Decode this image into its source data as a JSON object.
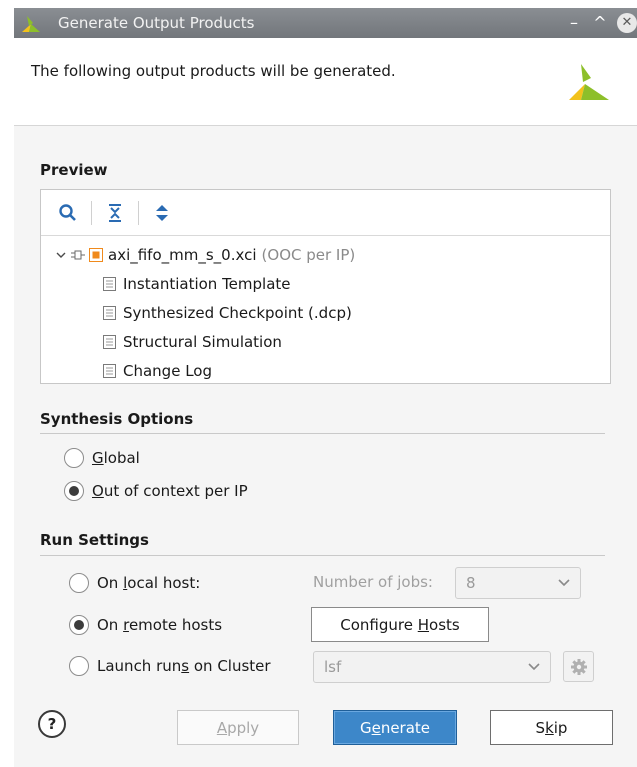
{
  "window": {
    "title": "Generate Output Products",
    "minimize": "–",
    "maximize": "^",
    "close": "✕"
  },
  "header": {
    "description": "The following output products will be generated."
  },
  "preview": {
    "title": "Preview",
    "tree": {
      "root": {
        "name": "axi_fifo_mm_s_0.xci",
        "note": "(OOC per IP)"
      },
      "children": [
        "Instantiation Template",
        "Synthesized Checkpoint (.dcp)",
        "Structural Simulation",
        "Change Log"
      ]
    }
  },
  "synthesis_options": {
    "title": "Synthesis Options",
    "options": [
      {
        "mnemonic": "G",
        "rest": "lobal",
        "selected": false
      },
      {
        "mnemonic": "O",
        "rest": "ut of context per IP",
        "selected": true
      }
    ]
  },
  "run_settings": {
    "title": "Run Settings",
    "local_host": {
      "before": "On ",
      "mnemonic": "l",
      "after": "ocal host:",
      "selected": false
    },
    "jobs_label": "Number of jobs:",
    "jobs_value": "8",
    "remote_hosts": {
      "before": "On ",
      "mnemonic": "r",
      "after": "emote hosts",
      "selected": true
    },
    "configure_hosts": {
      "before": "Configure ",
      "mnemonic": "H",
      "after": "osts"
    },
    "cluster": {
      "before": "Launch run",
      "mnemonic": "s",
      "after": " on Cluster",
      "selected": false
    },
    "cluster_value": "lsf"
  },
  "buttons": {
    "help": "?",
    "apply": {
      "mnemonic": "A",
      "rest": "pply"
    },
    "generate": {
      "before": "G",
      "mnemonic": "e",
      "after": "nerate"
    },
    "skip": {
      "before": "S",
      "mnemonic": "k",
      "after": "ip"
    }
  },
  "colors": {
    "accent": "#3d87c9",
    "logo_green": "#8dbf2a",
    "logo_yellow": "#f2c21b",
    "ip_orange": "#f08a1c"
  }
}
